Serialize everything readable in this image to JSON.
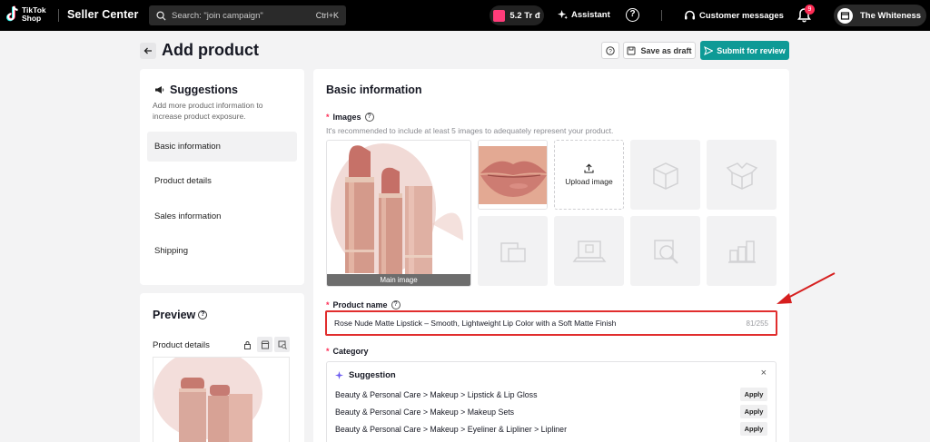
{
  "topbar": {
    "logo_line1": "TikTok",
    "logo_line2": "Shop",
    "app_name": "Seller Center",
    "search_placeholder": "Search: \"join campaign\"",
    "search_shortcut": "Ctrl+K",
    "coins": "5.2 Tr đ",
    "assistant": "Assistant",
    "customer_messages": "Customer messages",
    "notification_count": "9",
    "user_name": "The Whiteness"
  },
  "header": {
    "title": "Add product",
    "save_draft": "Save as draft",
    "submit": "Submit for review"
  },
  "suggestions": {
    "title": "Suggestions",
    "description": "Add more product information to increase product exposure.",
    "nav": [
      {
        "label": "Basic information",
        "active": true
      },
      {
        "label": "Product details",
        "active": false
      },
      {
        "label": "Sales information",
        "active": false
      },
      {
        "label": "Shipping",
        "active": false
      }
    ]
  },
  "preview": {
    "title": "Preview",
    "subtitle": "Product details"
  },
  "basic_info": {
    "title": "Basic information",
    "images_label": "Images",
    "images_hint": "It's recommended to include at least 5 images to adequately represent your product.",
    "main_image_label": "Main image",
    "upload_label": "Upload image",
    "product_name_label": "Product name",
    "product_name_value": "Rose Nude Matte Lipstick – Smooth, Lightweight Lip Color with a Soft Matte Finish",
    "product_name_count": "81/255",
    "category_label": "Category",
    "suggestion_title": "Suggestion",
    "apply_label": "Apply",
    "categories": [
      "Beauty & Personal Care > Makeup > Lipstick & Lip Gloss",
      "Beauty & Personal Care > Makeup > Makeup Sets",
      "Beauty & Personal Care > Makeup > Eyeliner & Lipliner > Lipliner"
    ]
  },
  "colors": {
    "accent": "#0e9a96",
    "highlight_border": "#e12e2e",
    "required": "#fe2c55",
    "annotation_arrow": "#d61f1f"
  }
}
